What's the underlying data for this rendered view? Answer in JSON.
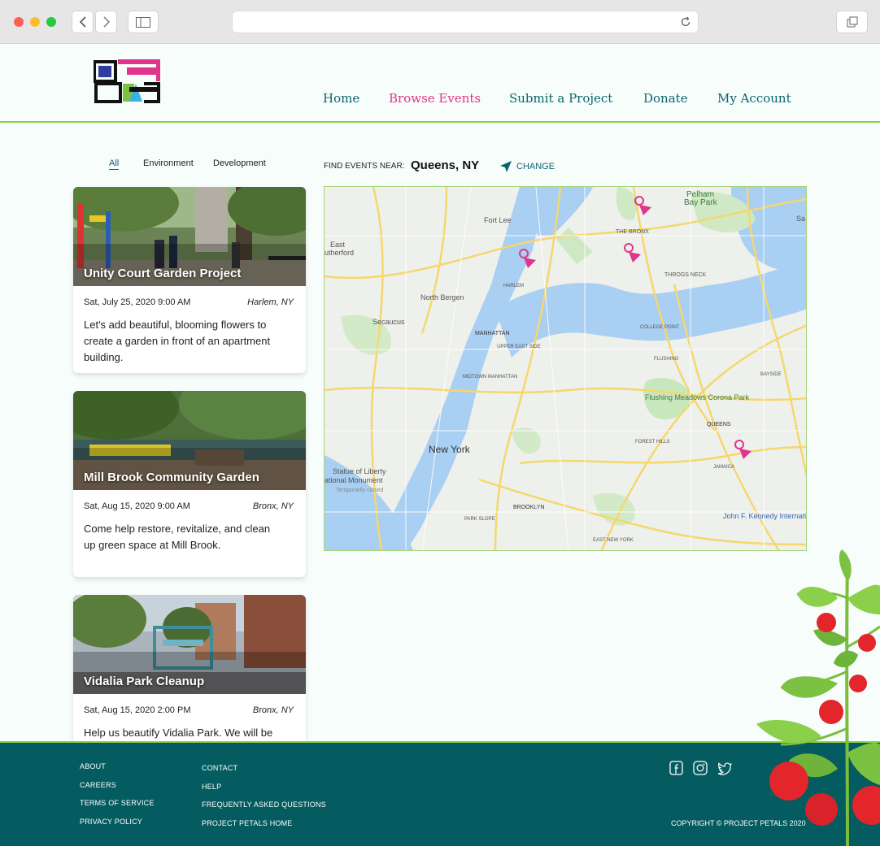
{
  "nav": {
    "items": [
      "Home",
      "Browse Events",
      "Submit a Project",
      "Donate",
      "My Account"
    ],
    "active": "Browse Events"
  },
  "filters": {
    "items": [
      "All",
      "Environment",
      "Development"
    ],
    "selected": "All"
  },
  "find": {
    "label": "FIND EVENTS NEAR:",
    "city": "Queens, NY",
    "change": "CHANGE"
  },
  "events": [
    {
      "title": "Unity Court Garden Project",
      "date": "Sat, July 25, 2020 9:00 AM",
      "location": "Harlem, NY",
      "description": "Let's add beautiful, blooming flowers to create a garden in front of an apartment building."
    },
    {
      "title": "Mill Brook Community Garden",
      "date": "Sat, Aug 15, 2020 9:00 AM",
      "location": "Bronx, NY",
      "description": "Come help restore, revitalize, and clean up green space at Mill Brook."
    },
    {
      "title": "Vidalia Park Cleanup",
      "date": "Sat, Aug 15, 2020 2:00 PM",
      "location": "Bronx, NY",
      "description": "Help us beautify Vidalia Park. We will be"
    }
  ],
  "map": {
    "labels": {
      "pelham": "Pelham",
      "bay_park": "Bay Park",
      "fort_lee": "Fort Lee",
      "east": "East",
      "rutherford": "utherford",
      "bronx": "THE BRONX",
      "throgs_neck": "THROGS NECK",
      "north_bergen": "North Bergen",
      "harlem": "HARLEM",
      "secaucus": "Secaucus",
      "manhattan": "MANHATTAN",
      "upper_east_side": "UPPER EAST SIDE",
      "college_point": "COLLEGE POINT",
      "flushing": "FLUSHING",
      "bayside": "BAYSIDE",
      "midtown": "MIDTOWN MANHATTAN",
      "flushing_meadows": "Flushing Meadows Corona Park",
      "queens": "QUEENS",
      "forest_hills": "FOREST HILLS",
      "new_york": "New York",
      "jamaica": "JAMAICA",
      "statue": "Statue of Liberty",
      "national_monument": "ational Monument",
      "temp_closed": "Temporarily closed",
      "brooklyn": "BROOKLYN",
      "park_slope": "PARK SLOPE",
      "jfk": "John F. Kennedy International Airport",
      "east_new_york": "EAST NEW YORK",
      "sands": "Sa"
    }
  },
  "footer": {
    "col1": [
      "ABOUT",
      "CAREERS",
      "TERMS OF SERVICE",
      "PRIVACY POLICY"
    ],
    "col2": [
      "CONTACT",
      "HELP",
      "FREQUENTLY ASKED QUESTIONS",
      "PROJECT PETALS HOME"
    ],
    "copyright": "COPYRIGHT © PROJECT PETALS 2020"
  },
  "colors": {
    "accent_pink": "#e0358a",
    "teal": "#0c6470",
    "footer_bg": "#055c60",
    "green_line": "#8ccf4a",
    "page_bg": "#f6fdfb"
  },
  "icons": [
    "back-arrow-icon",
    "forward-arrow-icon",
    "sidebar-icon",
    "reload-icon",
    "tabs-icon",
    "navigation-arrow-icon",
    "map-pin-icon",
    "facebook-icon",
    "instagram-icon",
    "twitter-icon"
  ]
}
